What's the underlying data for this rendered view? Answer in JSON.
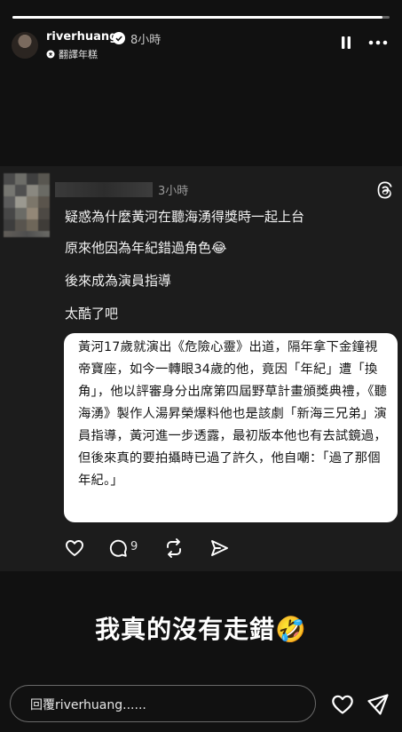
{
  "story": {
    "progress": 0.98,
    "username": "riverhuang",
    "time": "8小時",
    "translate_label": "翻譯年糕"
  },
  "post": {
    "time": "3小時",
    "lines": [
      "疑惑為什麼黃河在聽海湧得獎時一起上台",
      "原來他因為年紀錯過角色😂",
      "後來成為演員指導",
      "太酷了吧"
    ],
    "quote_text": "黃河17歲就演出《危險心靈》出道，隔年拿下金鐘視帝寶座，如今一轉眼34歲的他，竟因「年紀」遭「換角」，他以評審身分出席第四屆野草計畫頒獎典禮，《聽海湧》製作人湯昇榮爆料他也是該劇「新海三兄弟」演員指導，黃河進一步透露，最初版本他也有去試鏡過，但後來真的要拍攝時已過了許久，他自嘲：「過了那個年紀。」",
    "reply_count": "9"
  },
  "caption": "我真的沒有走錯🤣",
  "reply": {
    "placeholder": "回覆riverhuang......"
  },
  "colors": {
    "background": "#111111",
    "card": "#1c1c1c",
    "quote_bg": "#ffffff"
  },
  "icons": [
    "verified-badge-icon",
    "translate-icon",
    "pause-icon",
    "more-icon",
    "threads-icon",
    "heart-icon",
    "comment-icon",
    "repost-icon",
    "share-icon",
    "send-icon"
  ]
}
